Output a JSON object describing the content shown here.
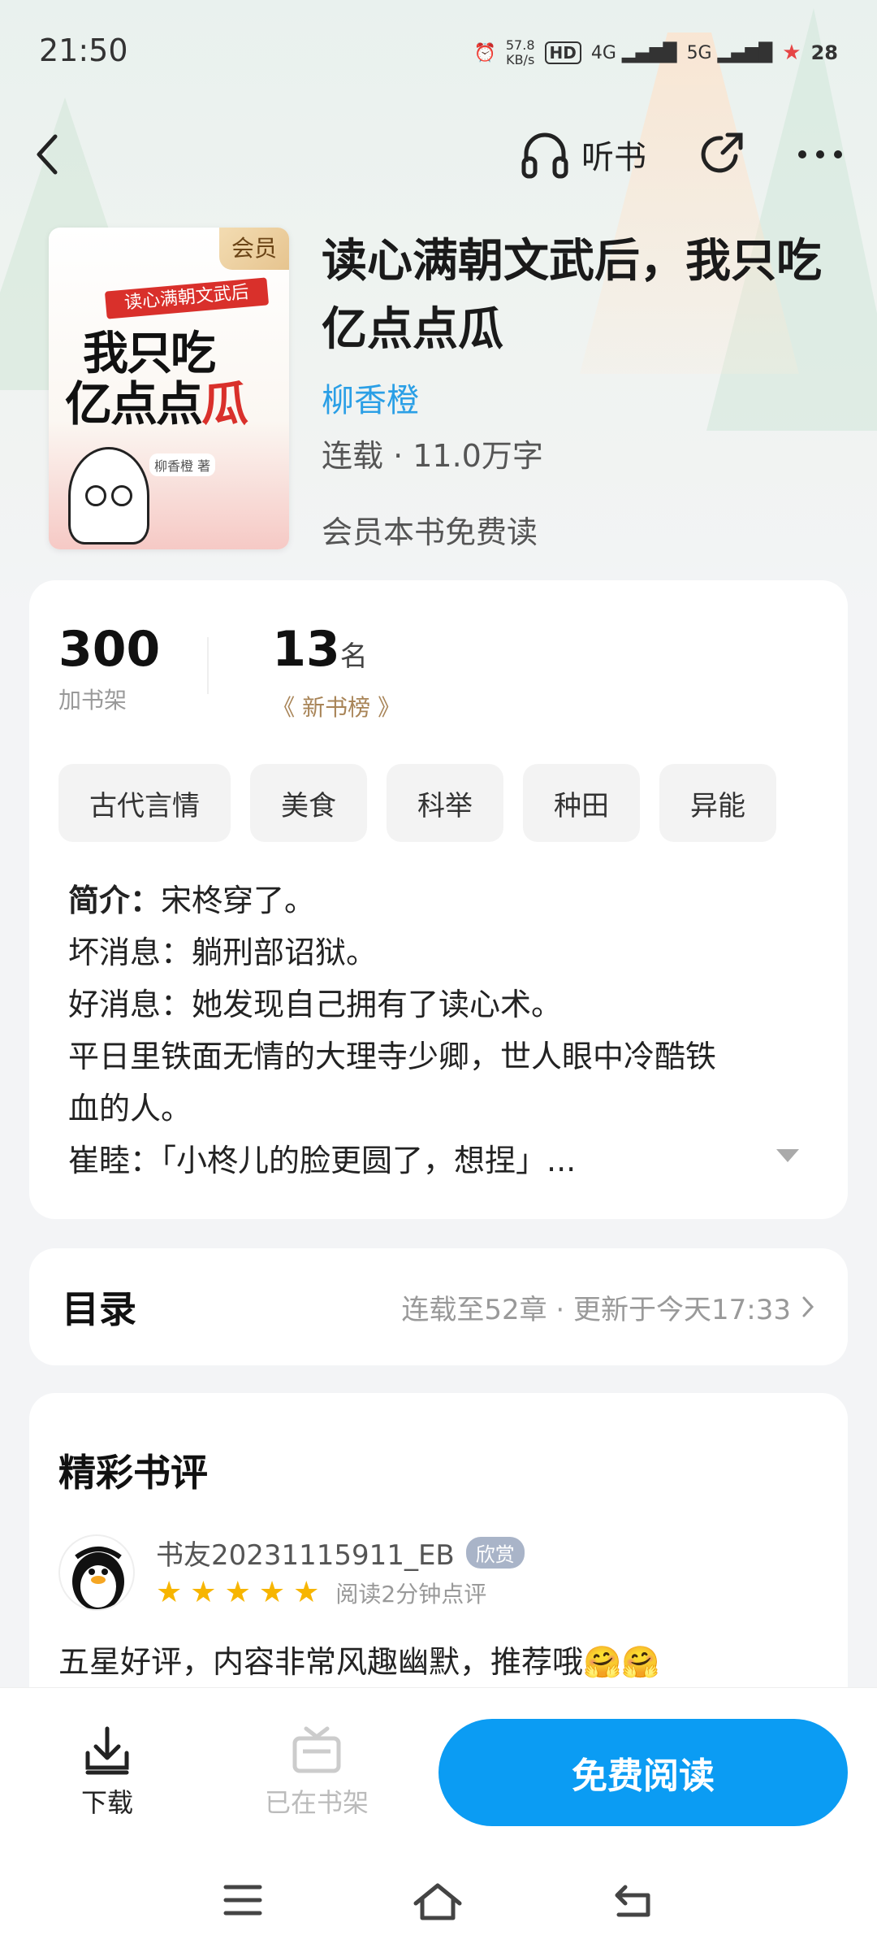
{
  "status_bar": {
    "time": "21:50",
    "net_speed": "57.8",
    "net_unit": "KB/s",
    "hd": "HD",
    "signal_1": "4G",
    "signal_2": "5G",
    "battery": "28"
  },
  "nav": {
    "listen_label": "听书"
  },
  "book": {
    "title": "读心满朝文武后，我只吃亿点点瓜",
    "author": "柳香橙",
    "meta": "连载 · 11.0万字",
    "vip_note": "会员本书免费读",
    "vip_badge": "会员",
    "cover_banner": "读心满朝文武后",
    "cover_title_line1": "我只吃",
    "cover_title_line2a": "亿点点",
    "cover_title_line2b": "瓜",
    "cover_author": "柳香橙 著"
  },
  "stats": {
    "shelf_count": "300",
    "shelf_label": "加书架",
    "rank_num": "13",
    "rank_unit": "名",
    "rank_label": "新书榜"
  },
  "tags": [
    "古代言情",
    "美食",
    "科举",
    "种田",
    "异能"
  ],
  "intro": {
    "label": "简介：",
    "lines": [
      "宋柊穿了。",
      "坏消息：躺刑部诏狱。",
      "好消息：她发现自己拥有了读心术。",
      "平日里铁面无情的大理寺少卿，世人眼中冷酷铁",
      "血的人。",
      "崔睦：「小柊儿的脸更圆了，想捏」..."
    ]
  },
  "toc": {
    "title": "目录",
    "status": "连载至52章 · 更新于今天17:33"
  },
  "reviews": {
    "heading": "精彩书评",
    "items": [
      {
        "name": "书友20231115911_EB",
        "badge": "欣赏",
        "stars": 5,
        "read_time": "阅读2分钟点评",
        "text": "五星好评，内容非常风趣幽默，推荐哦🤗🤗"
      }
    ]
  },
  "bottom": {
    "download_label": "下载",
    "shelf_label": "已在书架",
    "read_label": "免费阅读"
  },
  "colors": {
    "accent": "#0b9cf3",
    "author": "#2a9fe6",
    "star": "#f7b500",
    "rank": "#a88457"
  }
}
